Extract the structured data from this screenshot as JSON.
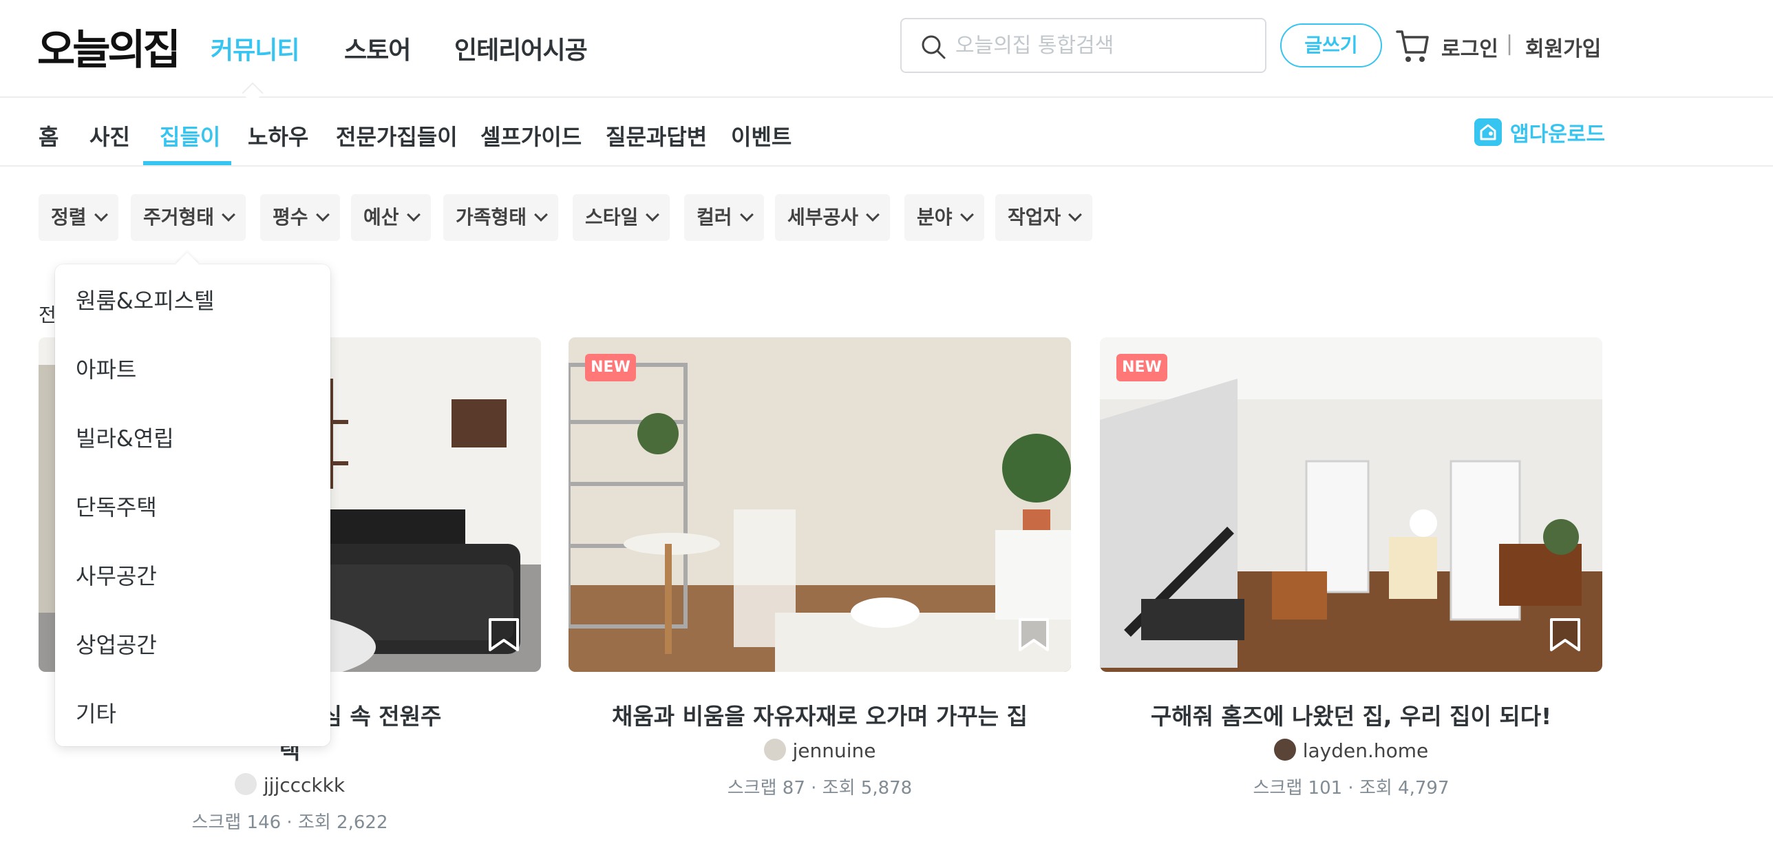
{
  "header": {
    "logo": "오늘의집",
    "nav": [
      {
        "label": "커뮤니티",
        "active": true
      },
      {
        "label": "스토어",
        "active": false
      },
      {
        "label": "인테리어시공",
        "active": false
      }
    ],
    "search": {
      "placeholder": "오늘의집 통합검색",
      "value": "",
      "icon": "search-icon"
    },
    "write_label": "글쓰기",
    "cart_icon": "cart-icon",
    "login_label": "로그인",
    "separator": "|",
    "signup_label": "회원가입",
    "accent_color": "#35c5f0"
  },
  "subnav": {
    "items": [
      {
        "label": "홈"
      },
      {
        "label": "사진"
      },
      {
        "label": "집들이"
      },
      {
        "label": "노하우"
      },
      {
        "label": "전문가집들이"
      },
      {
        "label": "셀프가이드"
      },
      {
        "label": "질문과답변"
      },
      {
        "label": "이벤트"
      }
    ],
    "active": "집들이",
    "app_download_label": "앱다운로드"
  },
  "filters": [
    {
      "label": "정렬"
    },
    {
      "label": "주거형태"
    },
    {
      "label": "평수"
    },
    {
      "label": "예산"
    },
    {
      "label": "가족형태"
    },
    {
      "label": "스타일"
    },
    {
      "label": "컬러"
    },
    {
      "label": "세부공사"
    },
    {
      "label": "분야"
    },
    {
      "label": "작업자"
    }
  ],
  "dropdown": {
    "for": "주거형태",
    "options": [
      "원룸&오피스텔",
      "아파트",
      "빌라&연립",
      "단독주택",
      "사무공간",
      "상업공간",
      "기타"
    ]
  },
  "total_label_partial": "전",
  "cards": [
    {
      "title_line1": "공간 디자이너의 도심 속 전원주",
      "title_line2": "택",
      "author": "jjjccckkk",
      "stats": "스크랩 146 · 조회 2,622",
      "is_new": false
    },
    {
      "title_line1": "채움과 비움을 자유자재로 오가며 가꾸는 집",
      "author": "jennuine",
      "stats": "스크랩 87 · 조회 5,878",
      "is_new": true,
      "badge": "NEW"
    },
    {
      "title_line1": "구해줘 홈즈에 나왔던 집, 우리 집이 되다!",
      "author": "layden.home",
      "stats": "스크랩 101 · 조회 4,797",
      "is_new": true,
      "badge": "NEW"
    }
  ]
}
